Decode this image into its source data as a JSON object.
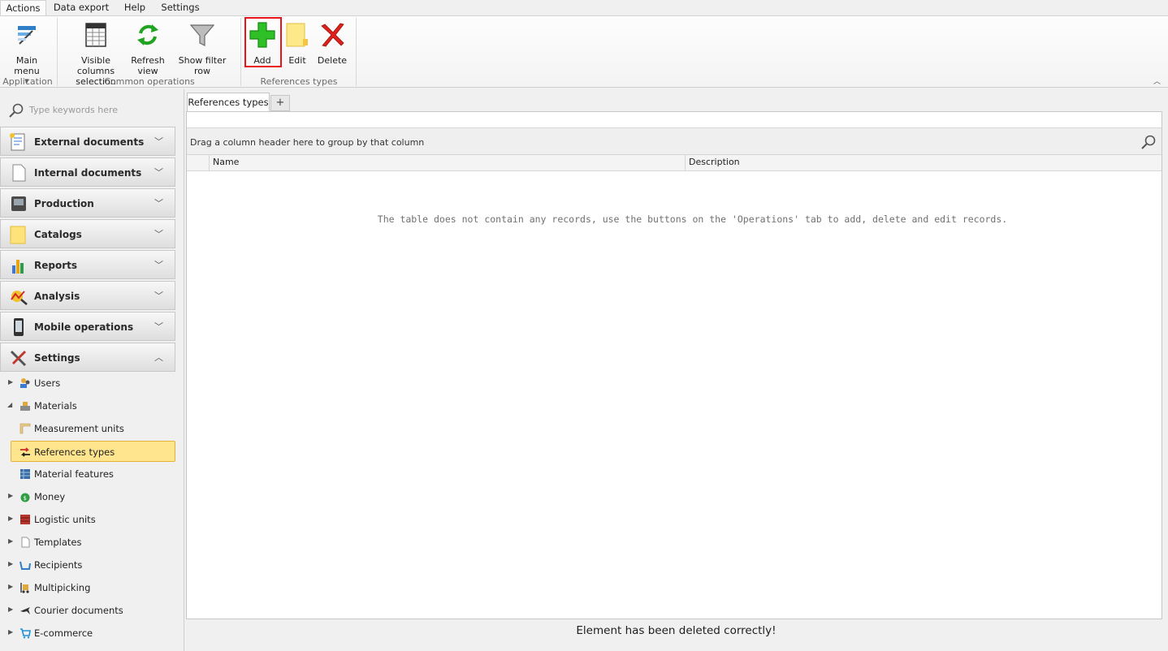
{
  "ribbon_tabs": [
    {
      "label": "Actions",
      "active": true
    },
    {
      "label": "Data export",
      "active": false
    },
    {
      "label": "Help",
      "active": false
    },
    {
      "label": "Settings",
      "active": false
    }
  ],
  "ribbon": {
    "main_menu": "Main menu",
    "visible_columns_1": "Visible columns",
    "visible_columns_2": "selection",
    "refresh_1": "Refresh",
    "refresh_2": "view",
    "filter_row": "Show filter row",
    "add": "Add",
    "edit": "Edit",
    "delete": "Delete",
    "groups": {
      "application": "Application",
      "common": "Common operations",
      "references": "References types"
    }
  },
  "search": {
    "placeholder": "Type keywords here"
  },
  "nav_groups": [
    {
      "label": "External documents",
      "icon": "document-list-icon"
    },
    {
      "label": "Internal documents",
      "icon": "blank-document-icon"
    },
    {
      "label": "Production",
      "icon": "machine-icon"
    },
    {
      "label": "Catalogs",
      "icon": "folder-icon"
    },
    {
      "label": "Reports",
      "icon": "bar-chart-icon"
    },
    {
      "label": "Analysis",
      "icon": "analysis-icon"
    },
    {
      "label": "Mobile operations",
      "icon": "mobile-phone-icon"
    },
    {
      "label": "Settings",
      "icon": "tools-icon"
    }
  ],
  "tree": [
    {
      "label": "Users",
      "icon": "users-icon"
    },
    {
      "label": "Materials",
      "icon": "materials-icon"
    },
    {
      "label": "Measurement units",
      "icon": "ruler-icon"
    },
    {
      "label": "References types",
      "icon": "arrows-icon"
    },
    {
      "label": "Material features",
      "icon": "grid-icon"
    },
    {
      "label": "Money",
      "icon": "money-bag-icon"
    },
    {
      "label": "Logistic units",
      "icon": "pallet-icon"
    },
    {
      "label": "Templates",
      "icon": "template-icon"
    },
    {
      "label": "Recipients",
      "icon": "recipients-icon"
    },
    {
      "label": "Multipicking",
      "icon": "forklift-icon"
    },
    {
      "label": "Courier documents",
      "icon": "plane-icon"
    },
    {
      "label": "E-commerce",
      "icon": "cart-icon"
    }
  ],
  "document_tab": "References types",
  "add_tab": "+",
  "grid": {
    "group_hint": "Drag a column header here to group by that column",
    "columns": [
      "Name",
      "Description"
    ],
    "empty_message": "The table does not contain any records, use the buttons on the 'Operations' tab to add, delete and edit records."
  },
  "status": "Element has been deleted correctly!"
}
